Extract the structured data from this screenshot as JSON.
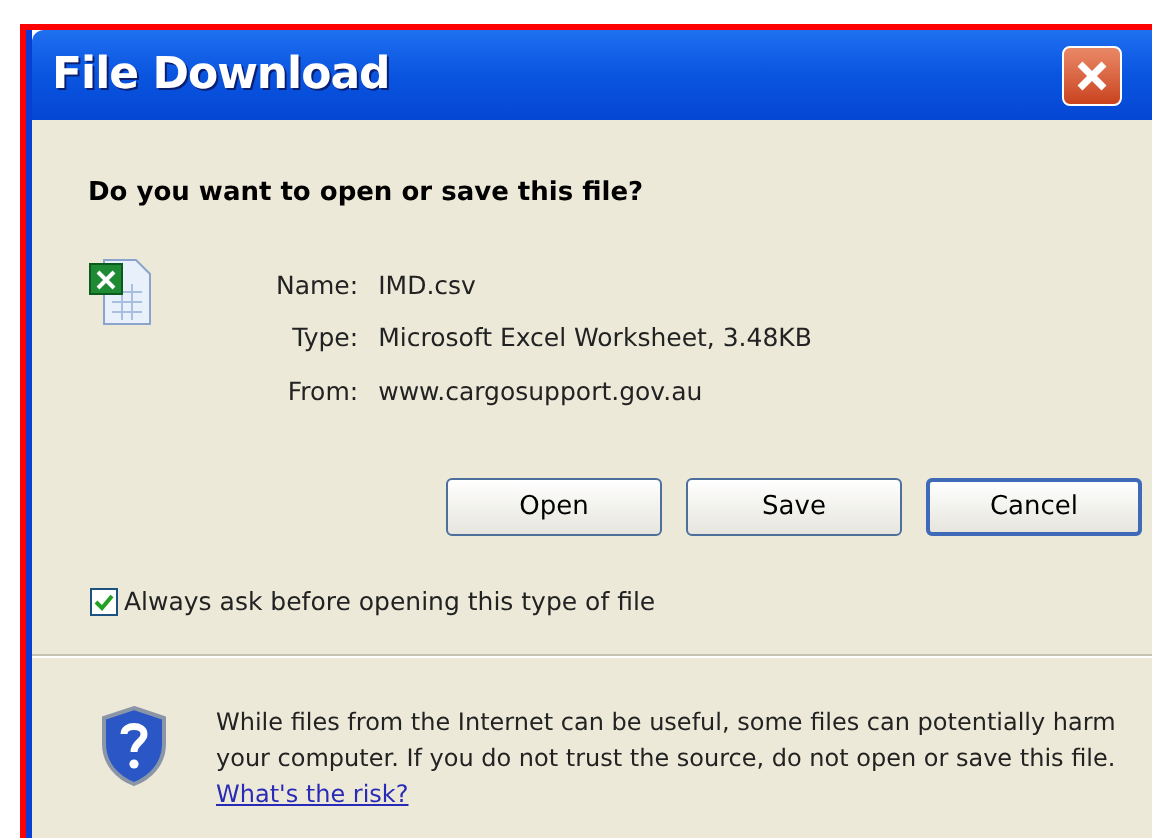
{
  "window": {
    "title": "File Download"
  },
  "question": "Do you want to open or save this file?",
  "file_info": [
    {
      "label": "Name:",
      "value": "IMD.csv"
    },
    {
      "label": "Type:",
      "value": "Microsoft Excel Worksheet, 3.48KB"
    },
    {
      "label": "From:",
      "value": "www.cargosupport.gov.au"
    }
  ],
  "buttons": [
    {
      "label": "Open",
      "default": false
    },
    {
      "label": "Save",
      "default": false
    },
    {
      "label": "Cancel",
      "default": true
    }
  ],
  "always_ask": {
    "label": "Always ask before opening this type of file",
    "checked": true
  },
  "warning": {
    "text": "While files from the Internet can be useful, some files can potentially harm your computer. If you do not trust the source, do not open or save this file.",
    "link": "What's the risk?"
  }
}
